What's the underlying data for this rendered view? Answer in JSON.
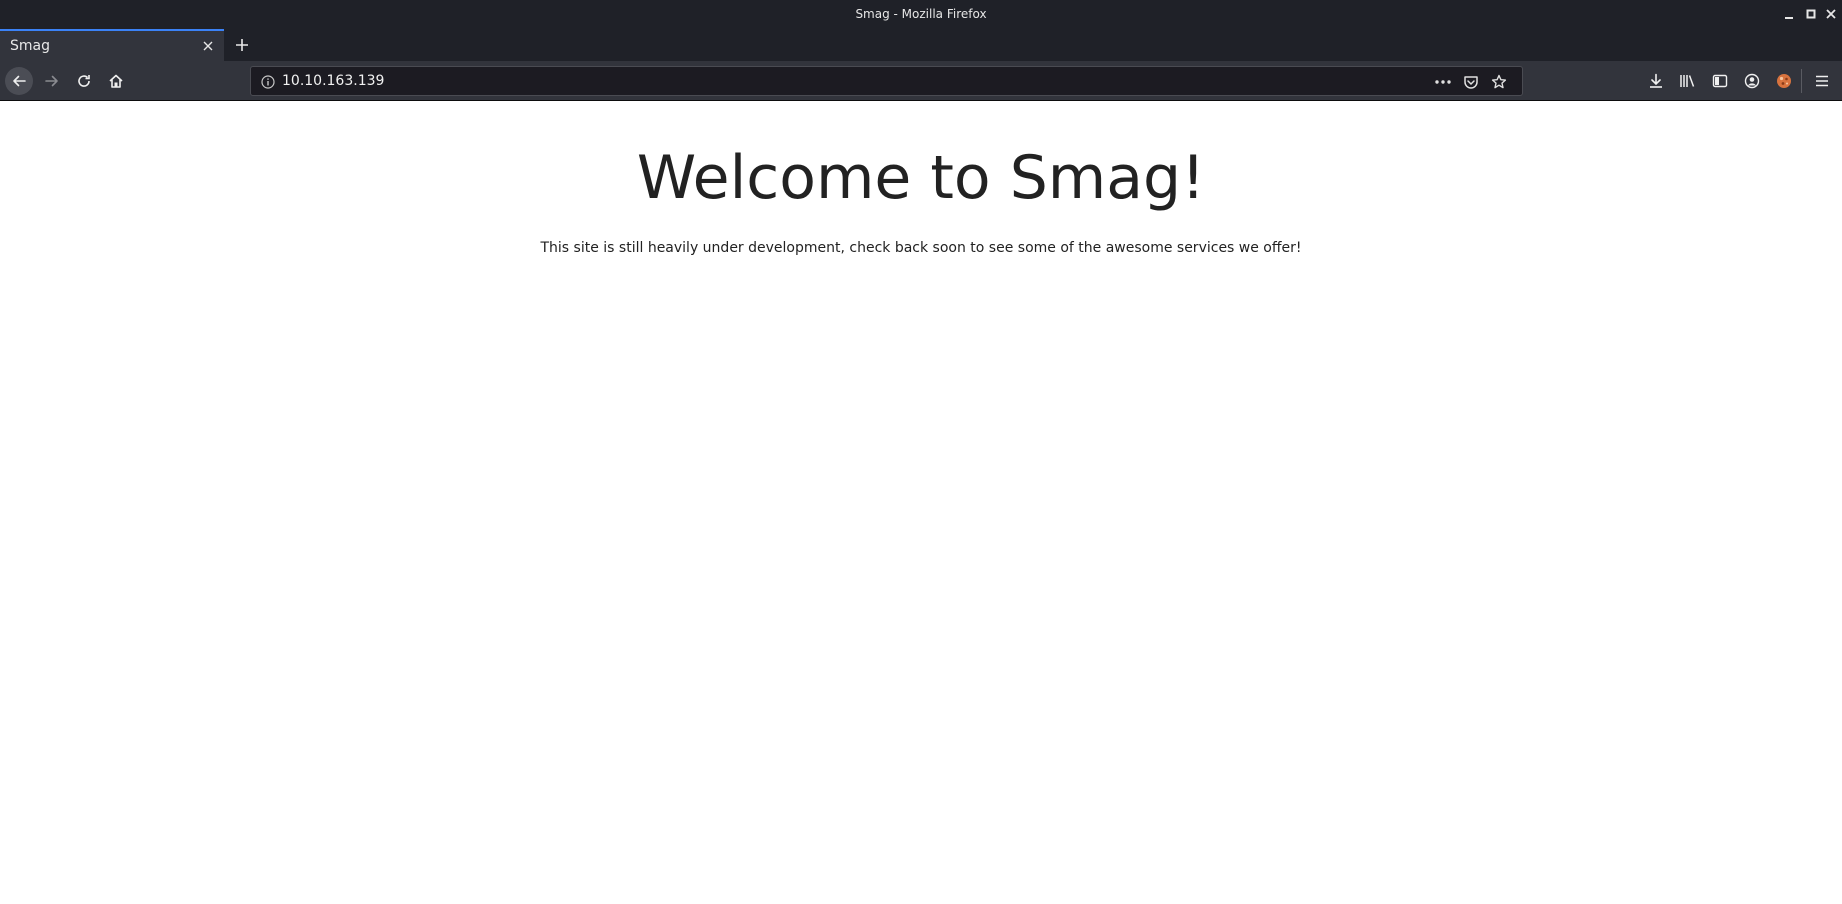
{
  "window": {
    "title": "Smag - Mozilla Firefox"
  },
  "tabs": [
    {
      "label": "Smag",
      "active": true
    }
  ],
  "navbar": {
    "url": "10.10.163.139"
  },
  "page": {
    "heading": "Welcome to Smag!",
    "text": "This site is still heavily under development, check back soon to see some of the awesome services we offer!"
  },
  "theme": {
    "chrome_bg": "#1f2128",
    "toolbar_bg": "#32343c",
    "tab_accent": "#3b82f6",
    "page_bg": "#ffffff"
  },
  "icons": {
    "minimize": "minimize-icon",
    "maximize": "maximize-icon",
    "close": "close-icon",
    "tab_close": "close-icon",
    "new_tab": "plus-icon",
    "back": "arrow-left-icon",
    "forward": "arrow-right-icon",
    "reload": "reload-icon",
    "home": "home-icon",
    "site_info": "info-icon",
    "page_actions": "more-dots-icon",
    "pocket": "pocket-icon",
    "bookmark": "star-icon",
    "downloads": "download-icon",
    "library": "library-icon",
    "sidebar": "sidebar-icon",
    "account": "account-icon",
    "extension": "extension-icon",
    "menu": "hamburger-menu-icon"
  }
}
